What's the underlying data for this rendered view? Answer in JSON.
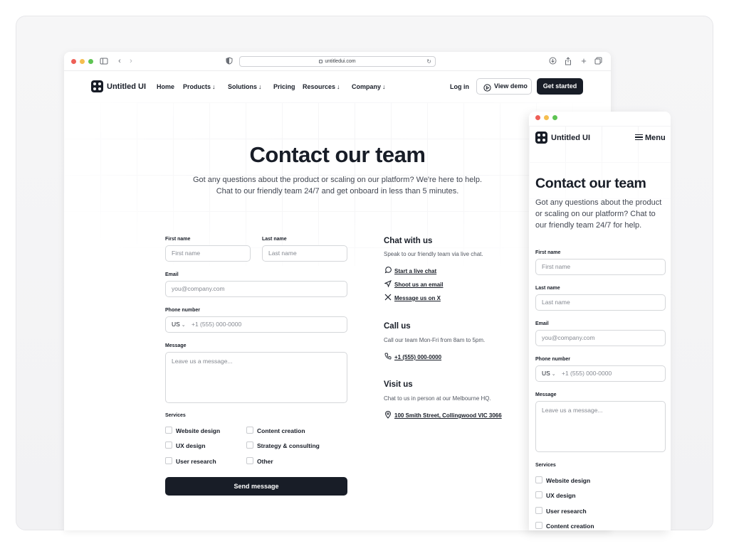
{
  "browser": {
    "url": "untitledui.com",
    "colors": {
      "close": "#ee5f57",
      "minimize": "#f5be4f",
      "maximize": "#5ec453"
    }
  },
  "nav": {
    "brand": "Untitled UI",
    "links": [
      {
        "label": "Home",
        "has_arrow": false
      },
      {
        "label": "Products",
        "has_arrow": true
      },
      {
        "label": "Solutions",
        "has_arrow": true
      },
      {
        "label": "Pricing",
        "has_arrow": false
      },
      {
        "label": "Resources",
        "has_arrow": true
      },
      {
        "label": "Company",
        "has_arrow": true
      }
    ],
    "login": "Log in",
    "view_demo": "View demo",
    "get_started": "Get started"
  },
  "hero": {
    "title": "Contact our team",
    "subtitle_line1": "Got any questions about the product or scaling on our platform? We're here to help.",
    "subtitle_line2": "Chat to our friendly team 24/7 and get onboard in less than 5 minutes."
  },
  "form": {
    "first_name_label": "First name",
    "first_name_placeholder": "First name",
    "last_name_label": "Last name",
    "last_name_placeholder": "Last name",
    "email_label": "Email",
    "email_placeholder": "you@company.com",
    "phone_label": "Phone number",
    "phone_country": "US",
    "phone_placeholder": "+1 (555) 000-0000",
    "message_label": "Message",
    "message_placeholder": "Leave us a message...",
    "services_label": "Services",
    "services": [
      "Website design",
      "Content creation",
      "UX design",
      "Strategy & consulting",
      "User research",
      "Other"
    ],
    "submit": "Send message"
  },
  "contact": {
    "chat_title": "Chat with us",
    "chat_desc": "Speak to our friendly team via live chat.",
    "chat_links": [
      "Start a live chat",
      "Shoot us an email",
      "Message us on X"
    ],
    "call_title": "Call us",
    "call_desc": "Call our team Mon-Fri from 8am to 5pm.",
    "call_phone": "+1 (555) 000-0000",
    "visit_title": "Visit us",
    "visit_desc": "Chat to us in person at our Melbourne HQ.",
    "visit_address": "100 Smith Street, Collingwood VIC 3066"
  },
  "mobile": {
    "brand": "Untitled UI",
    "menu": "Menu",
    "title": "Contact our team",
    "subtitle_lines": [
      "Got any questions about the product",
      "or scaling on our platform? Chat to",
      "our friendly team 24/7 for help."
    ],
    "first_name_label": "First name",
    "first_name_placeholder": "First name",
    "last_name_label": "Last name",
    "last_name_placeholder": "Last name",
    "email_label": "Email",
    "email_placeholder": "you@company.com",
    "phone_label": "Phone number",
    "phone_country": "US",
    "phone_placeholder": "+1 (555) 000-0000",
    "message_label": "Message",
    "message_placeholder": "Leave us a message...",
    "services_label": "Services",
    "services": [
      "Website design",
      "UX design",
      "User research",
      "Content creation"
    ]
  }
}
